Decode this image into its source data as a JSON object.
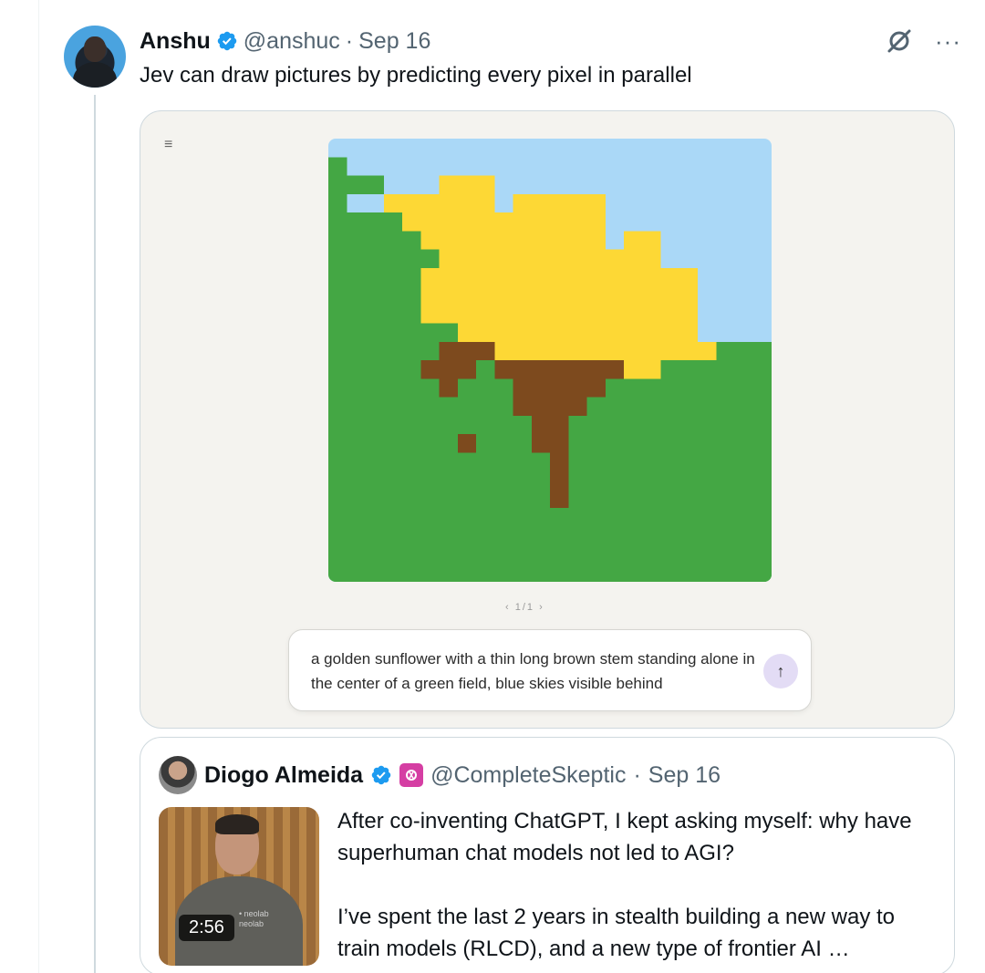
{
  "tweet": {
    "name": "Anshu",
    "handle": "@anshuc",
    "separator": "·",
    "date": "Sep 16",
    "text": "Jev can draw pictures by predicting every pixel in parallel",
    "more_label": "···"
  },
  "media": {
    "menu_label": "≡",
    "pager_label": "‹  1/1  ›",
    "prompt_text": "a golden sunflower with a thin long brown stem standing alone in the center of a green field, blue skies visible behind",
    "send_label": "↑"
  },
  "quote": {
    "name": "Diogo Almeida",
    "handle": "@CompleteSkeptic",
    "separator": "·",
    "date": "Sep 16",
    "duration": "2:56",
    "text": "After co-inventing ChatGPT, I kept asking myself: why have superhuman chat models not led to AGI?\n\nI’ve spent the last 2 years in stealth building a new way to train models (RLCD), and a new type of frontier AI …",
    "shirt_text": "• neolab\n neolab"
  },
  "colors": {
    "verified": "#1d9bf0",
    "sky": "#aad8f7",
    "grass": "#44a744",
    "petal": "#fdd835",
    "stem": "#7d4a1e",
    "affiliate_badge": "#d53ea3"
  },
  "icons": {
    "verified": "verified-badge-icon",
    "grok": "grok-icon",
    "more": "more-icon",
    "menu": "menu-icon",
    "send": "arrow-up-icon",
    "affiliate": "affiliate-badge-icon"
  }
}
